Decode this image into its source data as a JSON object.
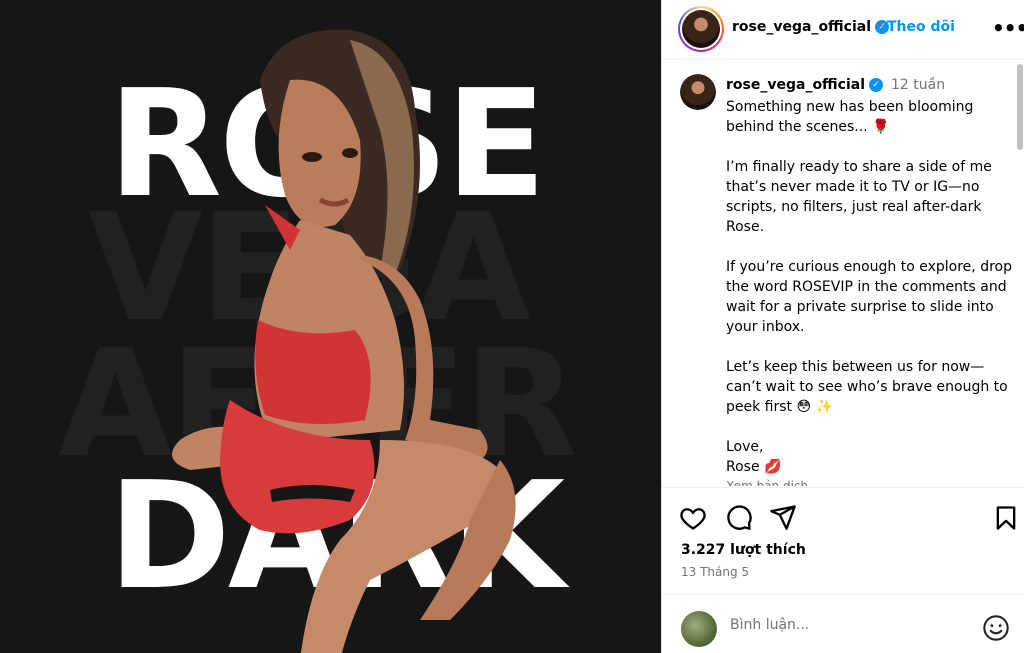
{
  "post_media": {
    "headline_top": "ROSE",
    "headline_middle_1": "VEGA",
    "headline_middle_2": "AFTER",
    "headline_bottom": "DARK"
  },
  "header": {
    "username": "rose_vega_official",
    "verified": true,
    "separator": "•",
    "follow_label": "Theo dõi",
    "more_icon": "more-horizontal-icon"
  },
  "caption": {
    "username": "rose_vega_official",
    "time": "12 tuần",
    "text": "Something new has been blooming behind the scenes... 🌹\n\nI’m finally ready to share a side of me that’s never made it to TV or IG—no scripts, no filters, just real after-dark Rose.\n\nIf you’re curious enough to explore, drop the word ROSEVIP in the comments and wait for a private surprise to slide into your inbox.\n\nLet’s keep this between us for now—can’t wait to see who’s brave enough to peek first 😳 ✨\n\nLove,\nRose 💋",
    "see_translation": "Xem bản dịch"
  },
  "actions": {
    "like_icon": "heart-icon",
    "comment_icon": "comment-icon",
    "share_icon": "send-icon",
    "save_icon": "bookmark-icon",
    "likes": "3.227 lượt thích",
    "date": "13 Tháng 5"
  },
  "comment_box": {
    "placeholder": "Bình luận...",
    "emoji_icon": "smiley-icon"
  },
  "colors": {
    "accent": "#0095f6",
    "media_bg": "#161616",
    "muted_text": "#737373"
  }
}
